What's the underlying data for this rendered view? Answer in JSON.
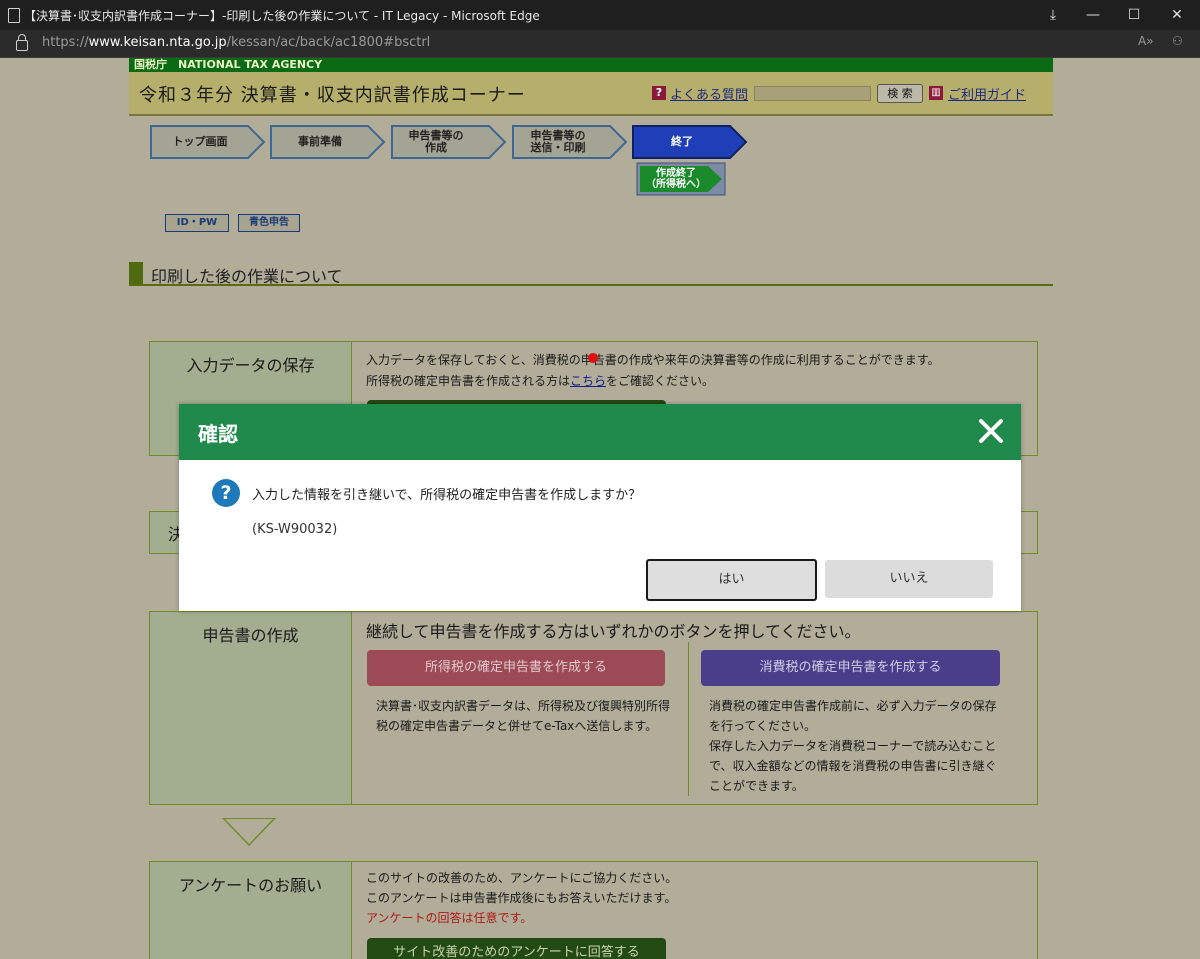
{
  "browser": {
    "title": "【決算書･収支内訳書作成コーナー】-印刷した後の作業について - IT Legacy - Microsoft Edge",
    "url_scheme": "https://",
    "url_host": "www.keisan.nta.go.jp",
    "url_path": "/kessan/ac/back/ac1800#bsctrl",
    "read_aloud": "A»"
  },
  "header": {
    "agency_label": "国税庁　NATIONAL TAX AGENCY",
    "corner_title": "令和３年分 決算書・収支内訳書作成コーナー",
    "faq_label": "よくある質問",
    "search_button": "検 索",
    "guide_label": "ご利用ガイド",
    "help_glyph": "?",
    "guide_glyph": "[]"
  },
  "steps": [
    {
      "label": "トップ画面"
    },
    {
      "label": "事前準備"
    },
    {
      "label": "申告書等の\n作成"
    },
    {
      "label": "申告書等の\n送信・印刷"
    },
    {
      "label": "終了"
    }
  ],
  "substep": {
    "label": "作成終了\n（所得税へ）"
  },
  "small_buttons": {
    "idpw": "ID・PW",
    "aoiro": "青色申告"
  },
  "section_title": "印刷した後の作業について",
  "rows": {
    "save": {
      "head": "入力データの保存",
      "line1": "入力データを保存しておくと、消費税の申告書の作成や来年の決算書等の作成に利用することができます。",
      "line2_pre": "所得税の確定申告書を作成される方は",
      "line2_link": "こちら",
      "line2_post": "をご確認ください。"
    },
    "hidden_head": "決",
    "create": {
      "head": "申告書の作成",
      "lead": "継続して申告書を作成する方はいずれかのボタンを押してください。",
      "income_button": "所得税の確定申告書を作成する",
      "income_desc": "決算書･収支内訳書データは、所得税及び復興特別所得税の確定申告書データと併せてe-Taxへ送信します。",
      "consumption_button": "消費税の確定申告書を作成する",
      "consumption_desc1": "消費税の確定申告書作成前に、必ず入力データの保存を行ってください。",
      "consumption_desc2": "保存した入力データを消費税コーナーで読み込むことで、収入金額などの情報を消費税の申告書に引き継ぐことができます。"
    },
    "survey": {
      "head": "アンケートのお願い",
      "line1": "このサイトの改善のため、アンケートにご協力ください。",
      "line2": "このアンケートは申告書作成後にもお答えいただけます。",
      "line3": "アンケートの回答は任意です。",
      "button": "サイト改善のためのアンケートに回答する"
    }
  },
  "modal": {
    "title": "確認",
    "message": "入力した情報を引き継いで、所得税の確定申告書を作成しますか？",
    "code": "(KS-W90032)",
    "yes": "はい",
    "no": "いいえ",
    "question_glyph": "?"
  },
  "colors": {
    "modal_header": "#1f8a4c",
    "agency_bar": "#0a6b14",
    "active_step": "#1f3fb8",
    "question_icon": "#1d79b9"
  }
}
